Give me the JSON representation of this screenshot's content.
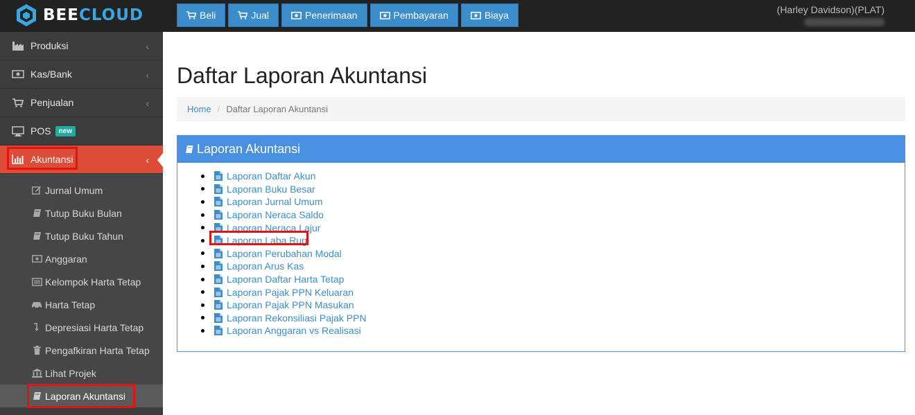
{
  "brand": {
    "name_part1": "BEE",
    "name_part2": "CLOUD"
  },
  "topnav": [
    {
      "label": "Beli",
      "icon": "cart-icon"
    },
    {
      "label": "Jual",
      "icon": "cart-icon"
    },
    {
      "label": "Penerimaan",
      "icon": "money-icon"
    },
    {
      "label": "Pembayaran",
      "icon": "money-icon"
    },
    {
      "label": "Biaya",
      "icon": "money-icon"
    }
  ],
  "user": {
    "company": "(Harley Davidson)(PLAT)"
  },
  "sidebar": {
    "items": [
      {
        "label": "Produksi",
        "icon": "industry-icon"
      },
      {
        "label": "Kas/Bank",
        "icon": "money-icon"
      },
      {
        "label": "Penjualan",
        "icon": "cart-icon"
      },
      {
        "label": "POS",
        "icon": "desktop-icon",
        "badge": "new"
      },
      {
        "label": "Akuntansi",
        "icon": "bar-chart-icon"
      }
    ],
    "submenu": [
      {
        "label": "Jurnal Umum",
        "icon": "edit-icon"
      },
      {
        "label": "Tutup Buku Bulan",
        "icon": "book-icon"
      },
      {
        "label": "Tutup Buku Tahun",
        "icon": "book-icon"
      },
      {
        "label": "Anggaran",
        "icon": "money-icon"
      },
      {
        "label": "Kelompok Harta Tetap",
        "icon": "list-icon"
      },
      {
        "label": "Harta Tetap",
        "icon": "car-icon"
      },
      {
        "label": "Depresiasi Harta Tetap",
        "icon": "level-down-icon"
      },
      {
        "label": "Pengafkiran Harta Tetap",
        "icon": "trash-icon"
      },
      {
        "label": "Lihat Projek",
        "icon": "bank-icon"
      },
      {
        "label": "Laporan Akuntansi",
        "icon": "book-icon"
      }
    ]
  },
  "main": {
    "title": "Daftar Laporan Akuntansi",
    "breadcrumb": {
      "home": "Home",
      "current": "Daftar Laporan Akuntansi"
    },
    "panel": {
      "title": "Laporan Akuntansi",
      "reports": [
        "Laporan Daftar Akun",
        "Laporan Buku Besar",
        "Laporan Jurnal Umum",
        "Laporan Neraca Saldo",
        "Laporan Neraca Lajur",
        "Laporan Laba Rugi",
        "Laporan Perubahan Modal",
        "Laporan Arus Kas",
        "Laporan Daftar Harta Tetap",
        "Laporan Pajak PPN Keluaran",
        "Laporan Pajak PPN Masukan",
        "Laporan Rekonsiliasi Pajak PPN",
        "Laporan Anggaran vs Realisasi"
      ]
    }
  },
  "colors": {
    "accent": "#3c8dcb",
    "active": "#dd4b39",
    "panel": "#4a90e2",
    "highlight": "#e11313"
  }
}
